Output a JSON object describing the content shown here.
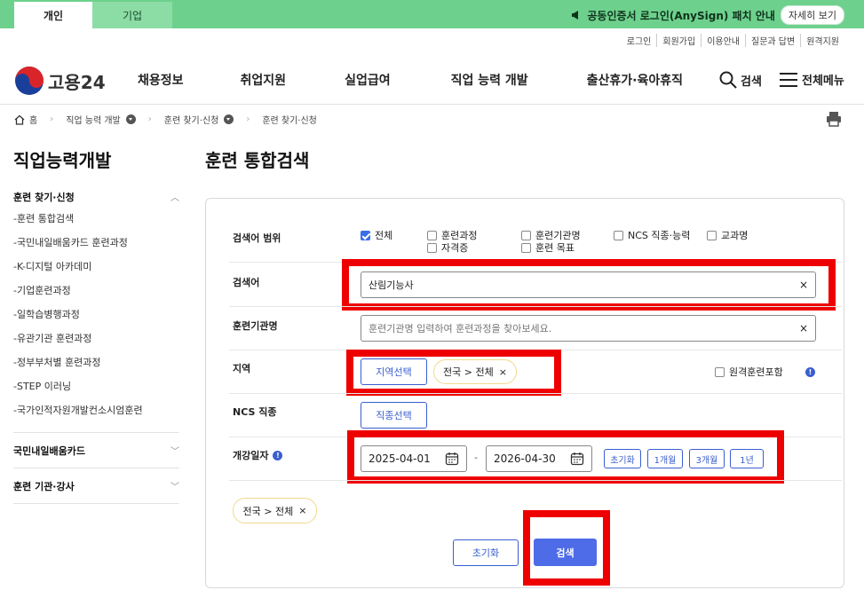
{
  "top_tabs": {
    "personal": "개인",
    "business": "기업"
  },
  "notice": {
    "text": "공동인증서 로그인(AnySign) 패치 안내",
    "more": "자세히 보기"
  },
  "util_links": [
    "로그인",
    "회원가입",
    "이용안내",
    "질문과 답변",
    "원격지원"
  ],
  "logo": {
    "text": "고용24"
  },
  "gnb": [
    "채용정보",
    "취업지원",
    "실업급여",
    "직업 능력 개발",
    "출산휴가·육아휴직"
  ],
  "header": {
    "search": "검색",
    "menu": "전체메뉴"
  },
  "breadcrumb": {
    "home": "홈",
    "level1": "직업 능력 개발",
    "level2": "훈련 찾기·신청",
    "level3": "훈련 찾기·신청"
  },
  "sidebar": {
    "title": "직업능력개발",
    "section1": "훈련 찾기·신청",
    "items": [
      "-훈련 통합검색",
      "-국민내일배움카드 훈련과정",
      "-K-디지털 아카데미",
      "-기업훈련과정",
      "-일학습병행과정",
      "-유관기관 훈련과정",
      "-정부부처별 훈련과정",
      "-STEP 이러닝",
      "-국가인적자원개발컨소시엄훈련"
    ],
    "section2": "국민내일배움카드",
    "section3": "훈련 기관·강사"
  },
  "main": {
    "title": "훈련 통합검색",
    "scope_label": "검색어 범위",
    "scope_options": [
      {
        "label": "전체",
        "checked": true
      },
      {
        "label": "훈련과정",
        "checked": false
      },
      {
        "label": "훈련기관명",
        "checked": false
      },
      {
        "label": "NCS 직종·능력",
        "checked": false
      },
      {
        "label": "교과명",
        "checked": false
      },
      {
        "label": "자격증",
        "checked": false
      },
      {
        "label": "훈련 목표",
        "checked": false
      }
    ],
    "keyword_label": "검색어",
    "keyword_value": "산림기능사",
    "institution_label": "훈련기관명",
    "institution_placeholder": "훈련기관명 입력하여 훈련과정을 찾아보세요.",
    "region_label": "지역",
    "region_button": "지역선택",
    "region_chip": "전국 > 전체",
    "remote_label": "원격훈련포함",
    "ncs_label": "NCS 직종",
    "ncs_button": "직종선택",
    "date_label": "개강일자",
    "date_from": "2025-04-01",
    "date_sep": "-",
    "date_to": "2026-04-30",
    "period_buttons": [
      "초기화",
      "1개월",
      "3개월",
      "1년"
    ],
    "selected_chip": "전국 > 전체",
    "reset_button": "초기화",
    "search_button": "검색"
  },
  "colors": {
    "topbar": "#6dd18d",
    "accent": "#3a5ecf",
    "search_button": "#4e6be8",
    "highlight": "#ee0000"
  }
}
